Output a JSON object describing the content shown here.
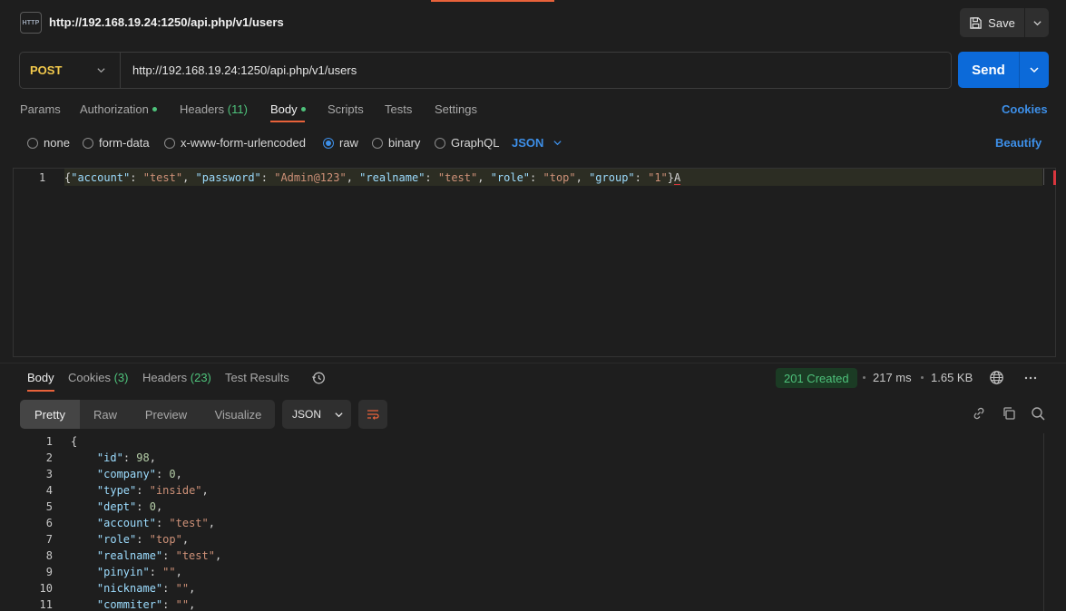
{
  "header": {
    "icon_text": "HTTP",
    "title": "http://192.168.19.24:1250/api.php/v1/users",
    "save_label": "Save"
  },
  "request": {
    "method": "POST",
    "url": "http://192.168.19.24:1250/api.php/v1/users",
    "send_label": "Send"
  },
  "req_tabs": {
    "params": "Params",
    "authorization": "Authorization",
    "headers": "Headers",
    "headers_count": "(11)",
    "body": "Body",
    "scripts": "Scripts",
    "tests": "Tests",
    "settings": "Settings",
    "cookies": "Cookies"
  },
  "body_types": {
    "none": "none",
    "form_data": "form-data",
    "urlencoded": "x-www-form-urlencoded",
    "raw": "raw",
    "binary": "binary",
    "graphql": "GraphQL",
    "selected": "raw",
    "language": "JSON",
    "beautify": "Beautify"
  },
  "request_body": {
    "line_number": "1",
    "pairs": [
      {
        "key": "\"account\"",
        "value": "\"test\""
      },
      {
        "key": "\"password\"",
        "value": "\"Admin@123\""
      },
      {
        "key": "\"realname\"",
        "value": "\"test\""
      },
      {
        "key": "\"role\"",
        "value": "\"top\""
      },
      {
        "key": "\"group\"",
        "value": "\"1\""
      }
    ],
    "trailing": "A"
  },
  "resp_tabs": {
    "body": "Body",
    "cookies": "Cookies",
    "cookies_count": "(3)",
    "headers": "Headers",
    "headers_count": "(23)",
    "test_results": "Test Results"
  },
  "response_meta": {
    "status": "201 Created",
    "time": "217 ms",
    "size": "1.65 KB"
  },
  "resp_view": {
    "pretty": "Pretty",
    "raw": "Raw",
    "preview": "Preview",
    "visualize": "Visualize",
    "format": "JSON"
  },
  "response_body": {
    "line_numbers": [
      "1",
      "2",
      "3",
      "4",
      "5",
      "6",
      "7",
      "8",
      "9",
      "10",
      "11"
    ],
    "open_brace": "{",
    "fields": [
      {
        "key": "\"id\"",
        "value": "98",
        "kind": "number"
      },
      {
        "key": "\"company\"",
        "value": "0",
        "kind": "number"
      },
      {
        "key": "\"type\"",
        "value": "\"inside\"",
        "kind": "string"
      },
      {
        "key": "\"dept\"",
        "value": "0",
        "kind": "number"
      },
      {
        "key": "\"account\"",
        "value": "\"test\"",
        "kind": "string"
      },
      {
        "key": "\"role\"",
        "value": "\"top\"",
        "kind": "string"
      },
      {
        "key": "\"realname\"",
        "value": "\"test\"",
        "kind": "string"
      },
      {
        "key": "\"pinyin\"",
        "value": "\"\"",
        "kind": "string"
      },
      {
        "key": "\"nickname\"",
        "value": "\"\"",
        "kind": "string"
      },
      {
        "key": "\"commiter\"",
        "value": "\"\"",
        "kind": "string"
      }
    ]
  },
  "colors": {
    "accent": "#e8623a",
    "send": "#0c6ad9",
    "link": "#3d8fe8",
    "success": "#4ec27b",
    "method": "#f2c94c"
  }
}
